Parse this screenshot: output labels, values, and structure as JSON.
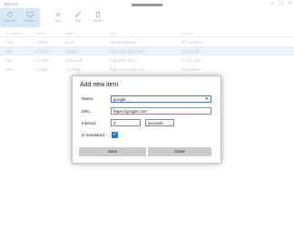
{
  "window": {
    "title": "Mipmon",
    "controls": [
      "—",
      "☐",
      "✕"
    ]
  },
  "toolbar": {
    "items": [
      {
        "label": "Refresh",
        "icon": "refresh-icon",
        "selected": true
      },
      {
        "label": "Monitor",
        "icon": "monitor-icon",
        "selected": true
      },
      {
        "label": "Add",
        "icon": "plus-icon",
        "selected": false
      },
      {
        "label": "Edit",
        "icon": "pencil-icon",
        "selected": false
      },
      {
        "label": "Delete",
        "icon": "trash-icon",
        "selected": false
      }
    ]
  },
  "table": {
    "columns": [
      "Is monitored",
      "Status",
      "Name",
      "URL",
      "Interval"
    ],
    "rows": [
      {
        "monitored": "Yes",
        "status": "• Offline",
        "name": "local",
        "url": "http://localhost",
        "interval": "10 minutes",
        "selected": false
      },
      {
        "monitored": "Yes",
        "status": "• Online",
        "name": "google",
        "url": "https://google.com",
        "interval": "3 seconds",
        "selected": true
      },
      {
        "monitored": "Yes",
        "status": "• Online",
        "name": "facebook",
        "url": "https://fb.com",
        "interval": "5 seconds",
        "selected": false
      },
      {
        "monitored": "Yes",
        "status": "• Online",
        "name": "YouTube",
        "url": "https://youtube.com",
        "interval": "2 minutes",
        "selected": false
      }
    ]
  },
  "dialog": {
    "title": "Add new item",
    "name_label": "Name:",
    "name_value": "google",
    "url_label": "URL:",
    "url_value": "https://google.com",
    "interval_label": "Interval:",
    "interval_value": "3",
    "interval_unit": "seconds",
    "monitored_label": "Is monitored:",
    "monitored_checked": true,
    "save_label": "Save",
    "close_label": "Close"
  },
  "colors": {
    "accent": "#1e78d6",
    "selection": "#cde4f7",
    "toolbar_selected": "#a9cdee",
    "button": "#cccccc"
  }
}
